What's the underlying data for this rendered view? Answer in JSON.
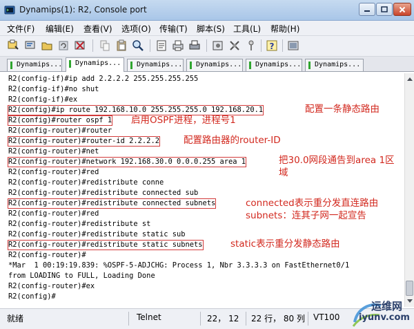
{
  "window": {
    "title": "Dynamips(1): R2, Console port",
    "icon": "terminal-app-icon"
  },
  "menu": [
    "文件(F)",
    "编辑(E)",
    "查看(V)",
    "选项(O)",
    "传输(T)",
    "脚本(S)",
    "工具(L)",
    "帮助(H)"
  ],
  "tabs": [
    {
      "label": "Dynamips...",
      "active": false
    },
    {
      "label": "Dynamips...",
      "active": true
    },
    {
      "label": "Dynamips...",
      "active": false
    },
    {
      "label": "Dynamips...",
      "active": false
    },
    {
      "label": "Dynamips...",
      "active": false
    },
    {
      "label": "Dynamips...",
      "active": false
    }
  ],
  "console": {
    "lines": [
      "R2(config-if)#ip add 2.2.2.2 255.255.255.255",
      "R2(config-if)#no shut",
      "R2(config-if)#ex",
      "R2(config)#ip route 192.168.10.0 255.255.255.0 192.168.20.1",
      "R2(config)#router ospf 1",
      "R2(config-router)#router",
      "R2(config-router)#router-id 2.2.2.2",
      "R2(config-router)#net",
      "R2(config-router)#network 192.168.30.0 0.0.0.255 area 1",
      "R2(config-router)#red",
      "R2(config-router)#redistribute conne",
      "R2(config-router)#redistribute connected sub",
      "R2(config-router)#redistribute connected subnets",
      "R2(config-router)#red",
      "R2(config-router)#redistribute st",
      "R2(config-router)#redistribute static sub",
      "R2(config-router)#redistribute static subnets",
      "R2(config-router)#",
      "*Mar  1 00:19:19.839: %OSPF-5-ADJCHG: Process 1, Nbr 3.3.3.3 on FastEthernet0/1",
      "from LOADING to FULL, Loading Done",
      "R2(config-router)#ex",
      "R2(config)#"
    ]
  },
  "annotations": {
    "static_route": "配置一条静态路由",
    "ospf_process": "启用OSPF进程，进程号1",
    "router_id": "配置路由器的router-ID",
    "network_l1": "把30.0网段通告到area 1区",
    "network_l2": "域",
    "connected_l1": "connected表示重分发直连路由",
    "connected_l2": "subnets：连其子网一起宣告",
    "static": "static表示重分发静态路由"
  },
  "status": {
    "state": "就绪",
    "protocol": "Telnet",
    "cursor": "22， 12",
    "size": "22 行， 80 列",
    "terminal": "VT100"
  },
  "watermark": {
    "name": "运维网",
    "url": "iyunv.com"
  },
  "colors": {
    "annotation": "#d2281e",
    "active_tab_indicator": "#2fa52f"
  }
}
